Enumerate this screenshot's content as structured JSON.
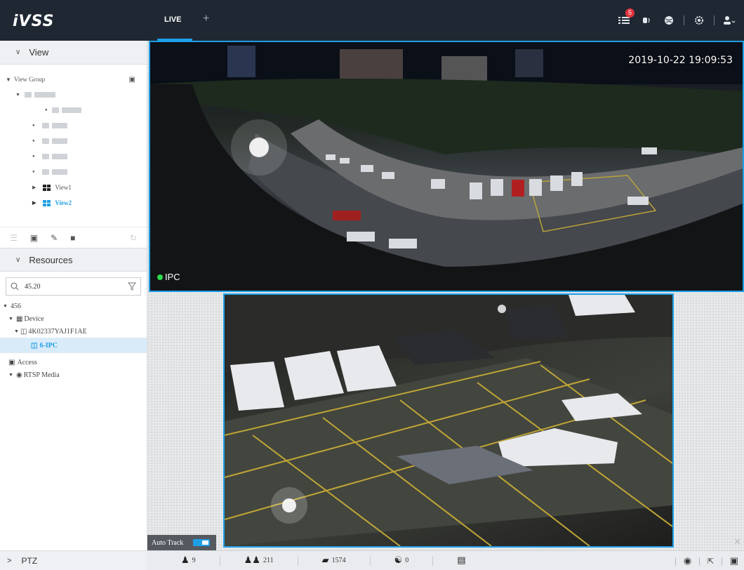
{
  "app": {
    "logo": "iVSS"
  },
  "topbar": {
    "tabs": [
      {
        "label": "LIVE"
      }
    ],
    "add_tab": "+",
    "icons": [
      {
        "name": "event-list-icon",
        "badge": "5"
      },
      {
        "name": "alarm-sound-icon"
      },
      {
        "name": "globe-icon"
      },
      {
        "name": "gear-icon"
      },
      {
        "name": "user-icon"
      }
    ]
  },
  "sidebar": {
    "view_section": {
      "title": "View",
      "group_label": "View Group",
      "views": [
        {
          "label": "View1"
        },
        {
          "label": "View2"
        }
      ]
    },
    "resources_section": {
      "title": "Resources",
      "search_value": "45.20",
      "tree": [
        {
          "label": "456"
        },
        {
          "label": "Device"
        },
        {
          "label": "4K02337YAJ1F1AE"
        },
        {
          "label": "6-IPC",
          "selected": true
        },
        {
          "label": "Access"
        },
        {
          "label": "RTSP Media"
        }
      ]
    },
    "ptz": {
      "label": "PTZ"
    }
  },
  "live": {
    "cam1": {
      "timestamp": "2019-10-22 19:09:53",
      "name": "IPC",
      "status_color": "#2ddc4b"
    },
    "cam2": {},
    "auto_track": {
      "label": "Auto Track",
      "enabled": true
    }
  },
  "stats": {
    "person": "9",
    "group": "211",
    "vehicle": "1574",
    "bike": "0"
  },
  "colors": {
    "accent": "#1e9fe6",
    "topbar": "#1f2733",
    "badge": "#e5323b"
  }
}
